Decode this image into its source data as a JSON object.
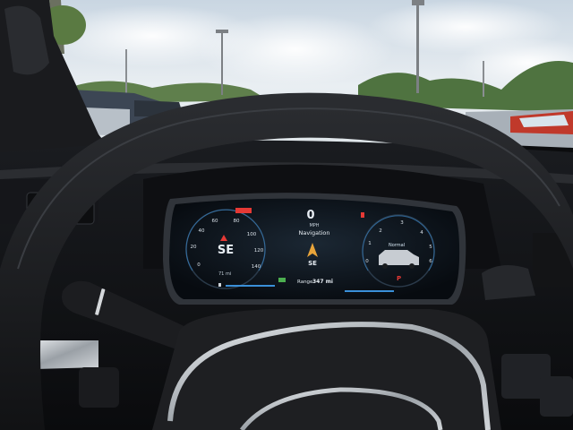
{
  "cluster": {
    "speed": "0",
    "speed_unit": "MPH",
    "nav_label": "Navigation",
    "heading_left": "SE",
    "heading_center": "SE",
    "trip": "71 mi",
    "drive_mode": "Normal",
    "range_label": "Range:",
    "range_value": "347 mi",
    "gear": "P"
  },
  "speedo_ticks": [
    "20",
    "40",
    "60",
    "80",
    "100",
    "120",
    "140",
    "0"
  ],
  "tach_ticks": [
    "1",
    "2",
    "3",
    "4",
    "5",
    "6",
    "0"
  ],
  "colors": {
    "cluster_accent": "#3a8fd8",
    "warning_red": "#e53935",
    "indicator_green": "#4caf50",
    "sky": "#dfe8ee"
  }
}
